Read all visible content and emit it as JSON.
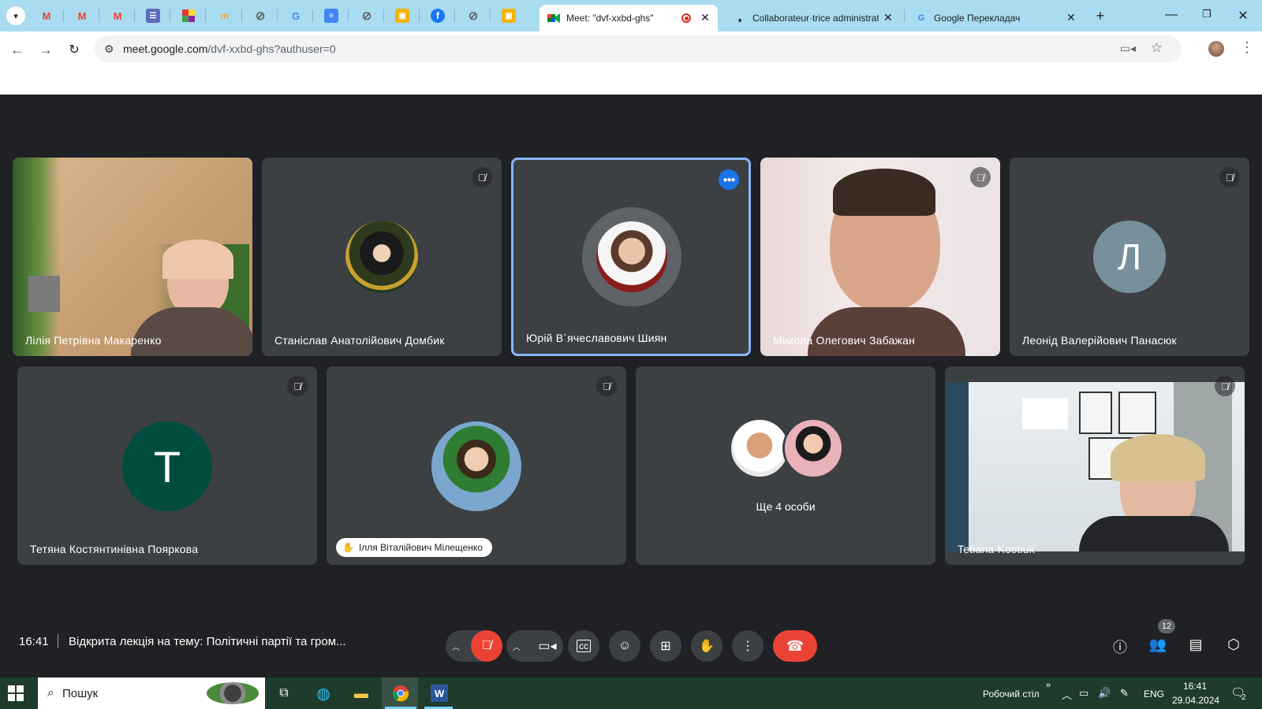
{
  "browser": {
    "tabs": [
      {
        "title": "Meet: \"dvf-xxbd-ghs\"",
        "active": true
      },
      {
        "title": "Collaborateur·trice administratif·ve"
      },
      {
        "title": "Google Перекладач"
      }
    ],
    "new_tab": "+",
    "url_host": "meet.google.com",
    "url_path": "/dvf-xxbd-ghs?authuser=0"
  },
  "meeting": {
    "time": "16:41",
    "title": "Відкрита лекція на тему: Політичні партії та гром...",
    "participants_count": "12",
    "tiles": [
      {
        "name": "Лілія Петрівна Макаренко"
      },
      {
        "name": "Станіслав Анатолійович Домбик"
      },
      {
        "name": "Юрій В`ячеславович Шиян"
      },
      {
        "name": "Микола Олегович Забажан"
      },
      {
        "name": "Леонід Валерійович Панасюк",
        "initial": "Л"
      },
      {
        "name": "Тетяна Костянтинівна Пояркова",
        "initial": "Т"
      },
      {
        "name": "Ілля Віталійович Мілещенко"
      },
      {
        "name": "Ще 4 особи"
      },
      {
        "name": "Tetiana Kostiuk"
      }
    ]
  },
  "taskbar": {
    "search_placeholder": "Пошук",
    "desktop_label": "Робочий стіл",
    "language": "ENG",
    "clock_time": "16:41",
    "clock_date": "29.04.2024",
    "notifications": "2"
  },
  "colors": {
    "meet_bg": "#202124",
    "tile_bg": "#3c4043",
    "end_call": "#ea4335",
    "speaking_border": "#8ab4f8",
    "tabstrip": "#a9dcf0"
  }
}
